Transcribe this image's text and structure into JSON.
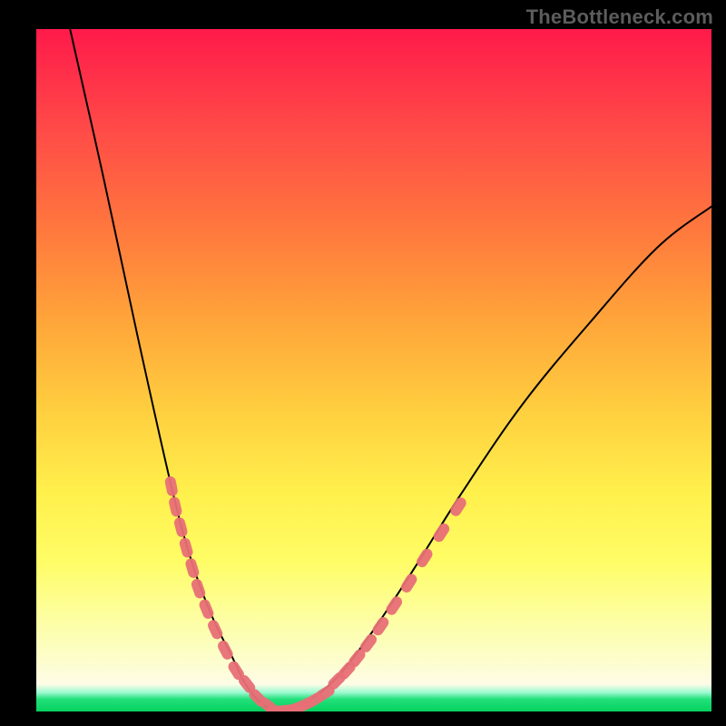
{
  "watermark": "TheBottleneck.com",
  "chart_data": {
    "type": "line",
    "title": "",
    "xlabel": "",
    "ylabel": "",
    "xlim": [
      0,
      1
    ],
    "ylim": [
      0,
      1
    ],
    "series": [
      {
        "name": "bottleneck-curve",
        "color": "#000000",
        "x": [
          0.05,
          0.1,
          0.15,
          0.2,
          0.23,
          0.26,
          0.29,
          0.31,
          0.33,
          0.355,
          0.38,
          0.41,
          0.45,
          0.5,
          0.56,
          0.63,
          0.72,
          0.82,
          0.92,
          1.0
        ],
        "y": [
          1.0,
          0.78,
          0.55,
          0.33,
          0.22,
          0.14,
          0.08,
          0.04,
          0.015,
          0.0,
          0.005,
          0.02,
          0.055,
          0.12,
          0.21,
          0.32,
          0.45,
          0.57,
          0.68,
          0.74
        ]
      },
      {
        "name": "left-marker-band",
        "type": "scatter",
        "color": "#e86f76",
        "x": [
          0.2,
          0.206,
          0.214,
          0.222,
          0.231,
          0.24,
          0.252,
          0.265,
          0.28,
          0.296,
          0.312,
          0.328,
          0.344
        ],
        "y": [
          0.33,
          0.3,
          0.27,
          0.24,
          0.21,
          0.18,
          0.15,
          0.12,
          0.09,
          0.06,
          0.04,
          0.02,
          0.008
        ]
      },
      {
        "name": "bottom-marker-band",
        "type": "scatter",
        "color": "#e86f76",
        "x": [
          0.355,
          0.365,
          0.375,
          0.386,
          0.398,
          0.412,
          0.428
        ],
        "y": [
          0.0,
          0.001,
          0.002,
          0.005,
          0.01,
          0.017,
          0.027
        ]
      },
      {
        "name": "right-marker-band",
        "type": "scatter",
        "color": "#e86f76",
        "x": [
          0.445,
          0.46,
          0.475,
          0.492,
          0.51,
          0.53,
          0.552,
          0.575,
          0.6,
          0.625
        ],
        "y": [
          0.045,
          0.06,
          0.078,
          0.1,
          0.125,
          0.155,
          0.188,
          0.225,
          0.262,
          0.3
        ]
      }
    ]
  }
}
